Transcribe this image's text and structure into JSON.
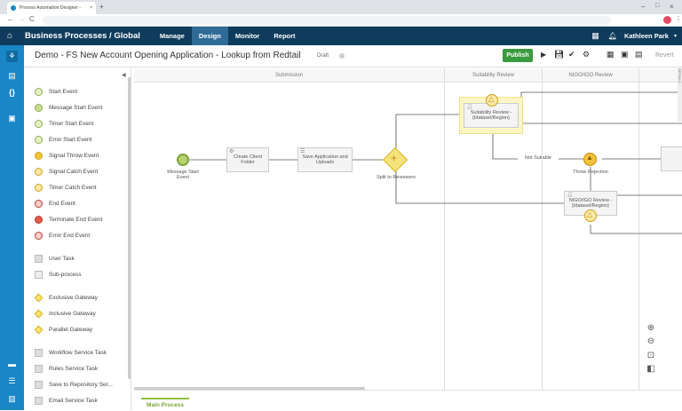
{
  "browser": {
    "tab_title": "Process Automation Designer -"
  },
  "appbar": {
    "title": "Business Processes / Global",
    "nav": [
      {
        "label": "Manage",
        "active": false
      },
      {
        "label": "Design",
        "active": true
      },
      {
        "label": "Monitor",
        "active": false
      },
      {
        "label": "Report",
        "active": false
      }
    ],
    "user": "Kathleen Park"
  },
  "titlebar": {
    "title": "Demo - FS New Account Opening Application - Lookup from Redtail",
    "status": "Draft",
    "publish": "Publish",
    "revert": "Revert"
  },
  "palette": {
    "items": [
      {
        "label": "Start Event",
        "icon": "start-event"
      },
      {
        "label": "Message Start Event",
        "icon": "message-start-event"
      },
      {
        "label": "Timer Start Event",
        "icon": "timer-start-event"
      },
      {
        "label": "Error Start Event",
        "icon": "error-start-event"
      },
      {
        "label": "Signal Throw Event",
        "icon": "signal-throw-event"
      },
      {
        "label": "Signal Catch Event",
        "icon": "signal-catch-event"
      },
      {
        "label": "Timer Catch Event",
        "icon": "timer-catch-event"
      },
      {
        "label": "End Event",
        "icon": "end-event"
      },
      {
        "label": "Terminate End Event",
        "icon": "terminate-end-event"
      },
      {
        "label": "Error End Event",
        "icon": "error-end-event"
      },
      {
        "label": "User Task",
        "icon": "user-task"
      },
      {
        "label": "Sub-process",
        "icon": "sub-process"
      },
      {
        "label": "Exclusive Gateway",
        "icon": "exclusive-gateway"
      },
      {
        "label": "Inclusive Gateway",
        "icon": "inclusive-gateway"
      },
      {
        "label": "Parallel Gateway",
        "icon": "parallel-gateway"
      },
      {
        "label": "Workflow Service Task",
        "icon": "workflow-service-task"
      },
      {
        "label": "Rules Service Task",
        "icon": "rules-service-task"
      },
      {
        "label": "Save to Repository Ser...",
        "icon": "save-repository-task"
      },
      {
        "label": "Email Service Task",
        "icon": "email-service-task"
      }
    ]
  },
  "lanes": {
    "submission": "Submission",
    "suitability": "Suitability Review",
    "nigo": "NIGO/IGO Review"
  },
  "diagram": {
    "message_start": "Message Start Event",
    "create_client": "Create Client Folder",
    "save_app": "Save Application and Uploads",
    "split": "Split to Reviewers",
    "suitability_task": "Suitability Review - {Idatasel/Region}",
    "not_suitable": "Not Suitable",
    "throw_rejection": "Throw Rejection",
    "nigo_task": "NIGO/IGO Review - {Idatasel/Region}"
  },
  "details_label": "DETAILS",
  "bottom": {
    "tab": "Main Process"
  }
}
